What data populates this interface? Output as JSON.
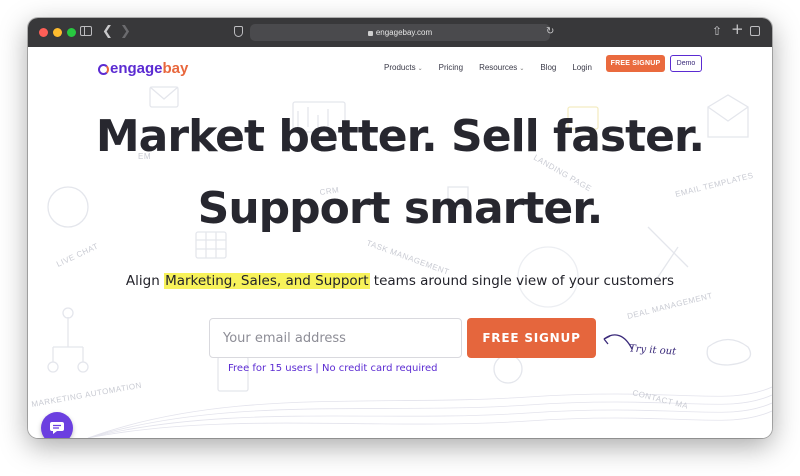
{
  "browser": {
    "url": "engagebay.com"
  },
  "header": {
    "logo_engage": "engage",
    "logo_bay": "bay",
    "nav": [
      {
        "label": "Products",
        "has_caret": true
      },
      {
        "label": "Pricing",
        "has_caret": false
      },
      {
        "label": "Resources",
        "has_caret": true
      },
      {
        "label": "Blog",
        "has_caret": false
      },
      {
        "label": "Login",
        "has_caret": false
      }
    ],
    "signup_label": "FREE SIGNUP",
    "demo_label": "Demo"
  },
  "hero": {
    "line1": "Market better. Sell faster.",
    "line2": "Support smarter.",
    "sub_before": "Align ",
    "sub_highlight": "Marketing, Sales, and Support",
    "sub_after": " teams around single view of your customers",
    "email_placeholder": "Your email address",
    "cta_label": "FREE SIGNUP",
    "try_label": "Try it out",
    "note": "Free for 15 users | No credit card required"
  },
  "background_labels": {
    "crm": "CRM",
    "task": "TASK MANAGEMENT",
    "landing": "LANDING PAGE",
    "email_templates": "EMAIL TEMPLATES",
    "live_chat": "LIVE CHAT",
    "deal": "DEAL MANAGEMENT",
    "contact": "CONTACT MA",
    "automation": "MARKETING AUTOMATION",
    "email": "EM"
  },
  "colors": {
    "brand_purple": "#5b2bd2",
    "brand_orange": "#e8673d",
    "highlight": "#f7f25a",
    "text_dark": "#27272f"
  },
  "icons": [
    "sidebar-icon",
    "back-arrow-icon",
    "forward-arrow-icon",
    "shield-icon",
    "lock-icon",
    "reload-icon",
    "share-icon",
    "new-tab-icon",
    "tab-overview-icon",
    "chat-icon"
  ]
}
